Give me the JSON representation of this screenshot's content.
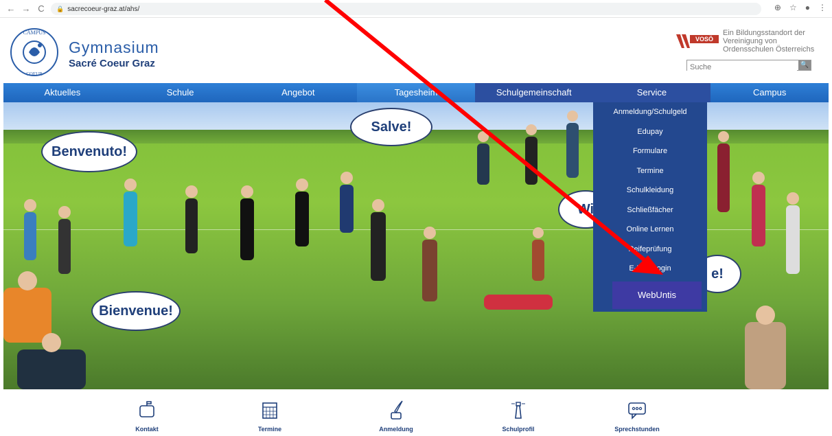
{
  "browser": {
    "url": "sacrecoeur-graz.at/ahs/"
  },
  "header": {
    "seal_text": "CAMPUS SACRE COEUR GRAZ",
    "title_line1": "Gymnasium",
    "title_line2": "Sacré Coeur Graz",
    "voso_logo_text": "VOSÖ",
    "voso_line1": "Ein Bildungsstandort der",
    "voso_line2": "Vereinigung von",
    "voso_line3": "Ordensschulen Österreichs",
    "search_placeholder": "Suche"
  },
  "nav": {
    "items": [
      {
        "label": "Aktuelles"
      },
      {
        "label": "Schule"
      },
      {
        "label": "Angebot"
      },
      {
        "label": "Tagesheim"
      },
      {
        "label": "Schulgemeinschaft"
      },
      {
        "label": "Service"
      },
      {
        "label": "Campus"
      }
    ]
  },
  "service_menu": {
    "items": [
      {
        "label": "Anmeldung/Schulgeld"
      },
      {
        "label": "Edupay"
      },
      {
        "label": "Formulare"
      },
      {
        "label": "Termine"
      },
      {
        "label": "Schulkleidung"
      },
      {
        "label": "Schließfächer"
      },
      {
        "label": "Online Lernen"
      },
      {
        "label": "Reifeprüfung"
      },
      {
        "label": "E-Mail Login"
      },
      {
        "label": "WebUntis"
      }
    ]
  },
  "hero": {
    "bubbles": {
      "benvenuto": "Benvenuto!",
      "salve": "Salve!",
      "bienvenue": "Bienvenue!",
      "wi": "Wi",
      "e": "e!"
    }
  },
  "footer": {
    "items": [
      {
        "label": "Kontakt"
      },
      {
        "label": "Termine"
      },
      {
        "label": "Anmeldung"
      },
      {
        "label": "Schulprofil"
      },
      {
        "label": "Sprechstunden"
      }
    ]
  },
  "colors": {
    "nav_blue": "#1f66bd",
    "menu_blue": "#23488f",
    "highlight": "#3e3aa3",
    "arrow_red": "#ff0000",
    "brand_text": "#2a5da8"
  }
}
